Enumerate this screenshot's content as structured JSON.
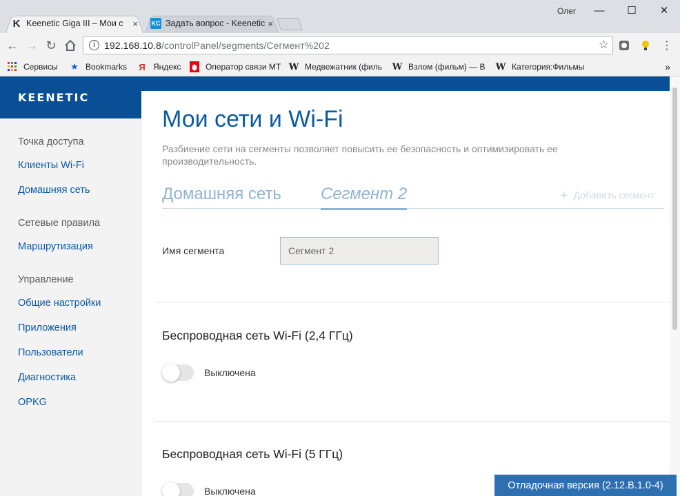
{
  "browser": {
    "tabs": [
      {
        "title": "Keenetic Giga III – Мои с",
        "close": "×"
      },
      {
        "title": "Задать вопрос - Keenetic",
        "close": "×"
      }
    ],
    "profile_name": "Олег",
    "window_controls": {
      "minimize": "—",
      "maximize": "☐",
      "close": "✕"
    },
    "url_host": "192.168.10.8",
    "url_path": "/controlPanel/segments/Сегмент%202",
    "bookmarks": [
      {
        "label": "Сервисы",
        "icon": "apps-grid-icon"
      },
      {
        "label": "Bookmarks",
        "icon": "star-icon"
      },
      {
        "label": "Яндекс",
        "icon": "yandex-icon"
      },
      {
        "label": "Оператор связи МТ",
        "icon": "mts-icon"
      },
      {
        "label": "Медвежатник (филь",
        "icon": "wikipedia-icon"
      },
      {
        "label": "Взлом (фильм) — В",
        "icon": "wikipedia-icon"
      },
      {
        "label": "Категория:Фильмы",
        "icon": "wikipedia-icon"
      }
    ],
    "bookmarks_overflow": "»"
  },
  "app": {
    "logo": "KEENETIC",
    "sidebar": {
      "group1": "Точка доступа",
      "group1_items": [
        "Клиенты Wi-Fi",
        "Домашняя сеть"
      ],
      "group2": "Сетевые правила",
      "group2_items": [
        "Маршрутизация"
      ],
      "group3": "Управление",
      "group3_items": [
        "Общие настройки",
        "Приложения",
        "Пользователи",
        "Диагностика",
        "OPKG"
      ]
    },
    "title": "Мои сети и Wi-Fi",
    "description": "Разбиение сети на сегменты позволяет повысить ее безопасность и оптимизировать ее производительность.",
    "segment_tabs": [
      "Домашняя сеть",
      "Сегмент 2"
    ],
    "add_segment": "Добавить сегмент",
    "segment_name_label": "Имя сегмента",
    "segment_name_value": "Сегмент 2",
    "wifi24": {
      "title": "Беспроводная сеть Wi-Fi (2,4 ГГц)",
      "state": "Выключена"
    },
    "wifi5": {
      "title": "Беспроводная сеть Wi-Fi (5 ГГц)",
      "state": "Выключена"
    },
    "debug_version": "Отладочная версия (2.12.B.1.0-4)"
  },
  "colors": {
    "brand": "#0a4f96",
    "link": "#0a5aa6",
    "tab": "#8fb3d4",
    "debug": "#2e6fb0"
  }
}
